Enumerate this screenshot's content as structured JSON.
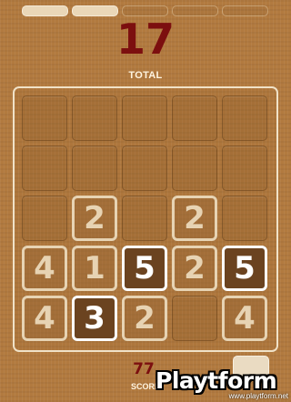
{
  "progress": {
    "segments": 5,
    "filled": 2
  },
  "header": {
    "total_value": "17",
    "total_label": "TOTAL"
  },
  "board": {
    "rows": 5,
    "cols": 5,
    "tiles": [
      {
        "row": 2,
        "col": 1,
        "value": "2",
        "style": "light"
      },
      {
        "row": 2,
        "col": 3,
        "value": "2",
        "style": "light"
      },
      {
        "row": 3,
        "col": 0,
        "value": "4",
        "style": "light"
      },
      {
        "row": 3,
        "col": 1,
        "value": "1",
        "style": "light"
      },
      {
        "row": 3,
        "col": 2,
        "value": "5",
        "style": "bright"
      },
      {
        "row": 3,
        "col": 3,
        "value": "2",
        "style": "light"
      },
      {
        "row": 3,
        "col": 4,
        "value": "5",
        "style": "bright"
      },
      {
        "row": 4,
        "col": 0,
        "value": "4",
        "style": "light"
      },
      {
        "row": 4,
        "col": 1,
        "value": "3",
        "style": "bright"
      },
      {
        "row": 4,
        "col": 2,
        "value": "2",
        "style": "light"
      },
      {
        "row": 4,
        "col": 4,
        "value": "4",
        "style": "light"
      }
    ]
  },
  "footer": {
    "score_value": "77",
    "score_label": "SCORE"
  },
  "watermark": {
    "logo_text": "Playtform",
    "url_text": "www.playtform.net"
  },
  "colors": {
    "background": "#b27a3f",
    "accent_red": "#7c0f0f",
    "tile_light": "#e7d3b3",
    "tile_bright": "#ffffff"
  }
}
